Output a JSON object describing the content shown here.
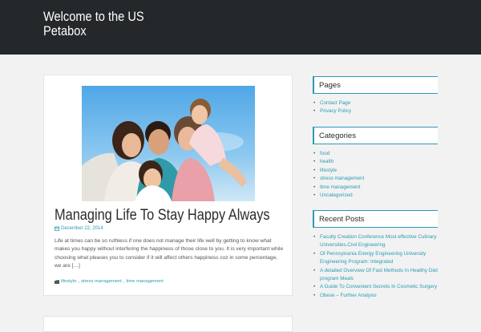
{
  "header": {
    "title_line1": "Welcome to the US",
    "title_line2": "Petabox"
  },
  "post": {
    "title": "Managing Life To Stay Happy Always",
    "date": "December 22, 2014",
    "excerpt": "Life at times can be so ruthless if one does not manage their life well by getting to know what makes you happy without interfering the happiness of those close to you. It is very important while choosing what pleases you to consider if it will affect others happiness coz in some percentage, we are […]",
    "tags": [
      "lifestyle",
      "stress management",
      "time management"
    ],
    "photo_icon": "family-photo",
    "date_icon": "calendar-icon",
    "tags_icon": "folder-icon"
  },
  "sidebar": {
    "pages": {
      "title": "Pages",
      "items": [
        "Contact Page",
        "Privacy Policy"
      ]
    },
    "categories": {
      "title": "Categories",
      "items": [
        "food",
        "health",
        "lifestyle",
        "stress management",
        "time management",
        "Uncategorized"
      ]
    },
    "recent_posts": {
      "title": "Recent Posts",
      "items": [
        "Faculty Creation Conference Most effective Culinary Universities.Civil Engineering",
        "Of Pennsylvania Energy Engineering University Engineering Program: Integrated",
        "A detailed Overview Of Fast Methods In Healthy Diet program Meals",
        "A Guide To Convenient Secrets In Cosmetic Surgery",
        "Obese – Further Analysis"
      ]
    }
  },
  "colors": {
    "accent": "#2a9bb5",
    "header_bg": "#24282b",
    "page_bg": "#f2f2f2"
  }
}
